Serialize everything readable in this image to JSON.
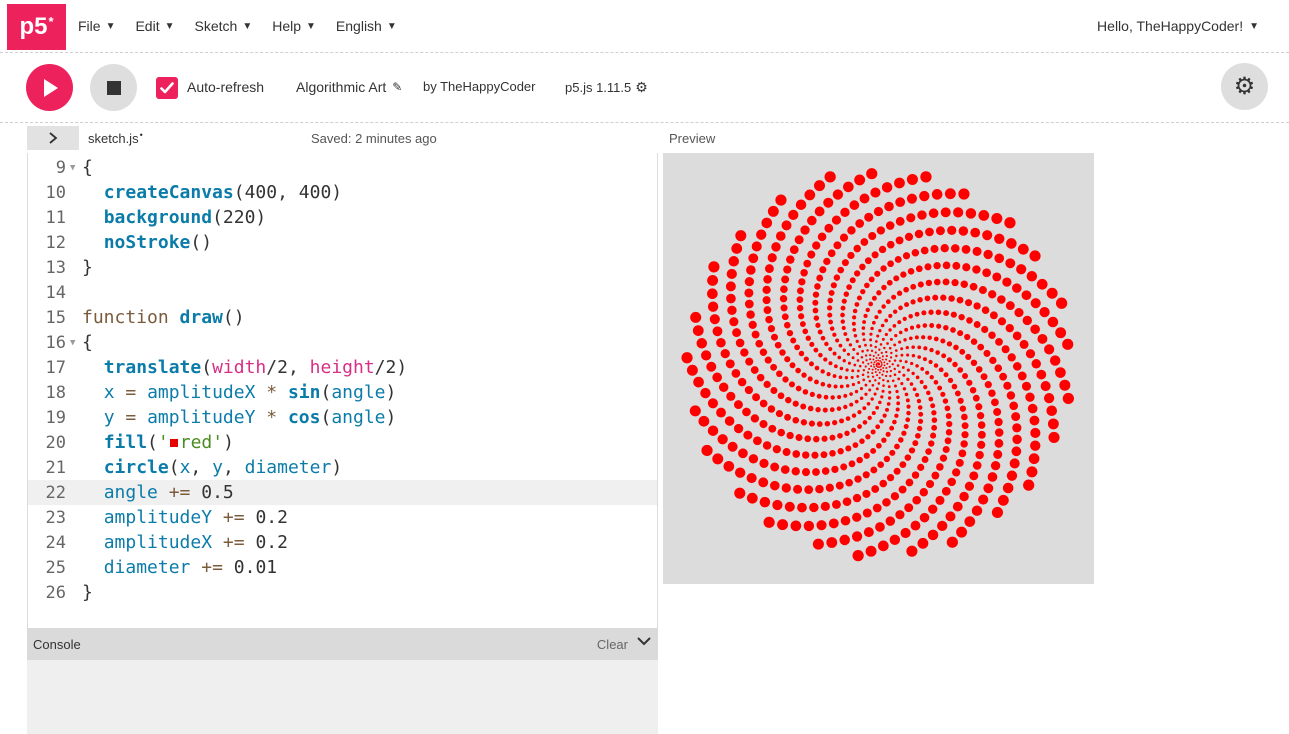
{
  "nav": {
    "logo": "p5",
    "logo_mark": "*",
    "menu": [
      {
        "label": "File"
      },
      {
        "label": "Edit"
      },
      {
        "label": "Sketch"
      },
      {
        "label": "Help"
      },
      {
        "label": "English"
      }
    ],
    "user": "Hello, TheHappyCoder!"
  },
  "toolbar": {
    "auto_refresh_label": "Auto-refresh",
    "auto_refresh_checked": true,
    "sketch_name": "Algorithmic Art",
    "by_author": "by TheHappyCoder",
    "version": "p5.js 1.11.5"
  },
  "editor": {
    "file_name": "sketch.js",
    "unsaved_dot": "•",
    "saved_status": "Saved: 2 minutes ago",
    "active_line": 22,
    "lines": [
      {
        "n": "9",
        "fold": true,
        "text": "{"
      },
      {
        "n": "10",
        "text": "  createCanvas(400, 400)"
      },
      {
        "n": "11",
        "text": "  background(220)"
      },
      {
        "n": "12",
        "text": "  noStroke()"
      },
      {
        "n": "13",
        "text": "}"
      },
      {
        "n": "14",
        "text": ""
      },
      {
        "n": "15",
        "text": "function draw()"
      },
      {
        "n": "16",
        "fold": true,
        "text": "{"
      },
      {
        "n": "17",
        "text": "  translate(width/2, height/2)"
      },
      {
        "n": "18",
        "text": "  x = amplitudeX * sin(angle)"
      },
      {
        "n": "19",
        "text": "  y = amplitudeY * cos(angle)"
      },
      {
        "n": "20",
        "text": "  fill('red')"
      },
      {
        "n": "21",
        "text": "  circle(x, y, diameter)"
      },
      {
        "n": "22",
        "text": "  angle += 0.5"
      },
      {
        "n": "23",
        "text": "  amplitudeY += 0.2"
      },
      {
        "n": "24",
        "text": "  amplitudeX += 0.2"
      },
      {
        "n": "25",
        "text": "  diameter += 0.01"
      },
      {
        "n": "26",
        "text": "}"
      }
    ]
  },
  "console": {
    "title": "Console",
    "clear_label": "Clear"
  },
  "preview": {
    "label": "Preview",
    "background_color": "#dcdcdc",
    "dot_color": "#ff0000",
    "sketch_params": {
      "angle_step": 0.5,
      "amplitude_step": 0.2,
      "diameter_step": 0.01,
      "canvas": 400
    }
  },
  "colors": {
    "accent": "#ed225d",
    "keyword_function": "#0b7ca9",
    "string": "#4b8b1f",
    "argument": "#d72f86"
  }
}
